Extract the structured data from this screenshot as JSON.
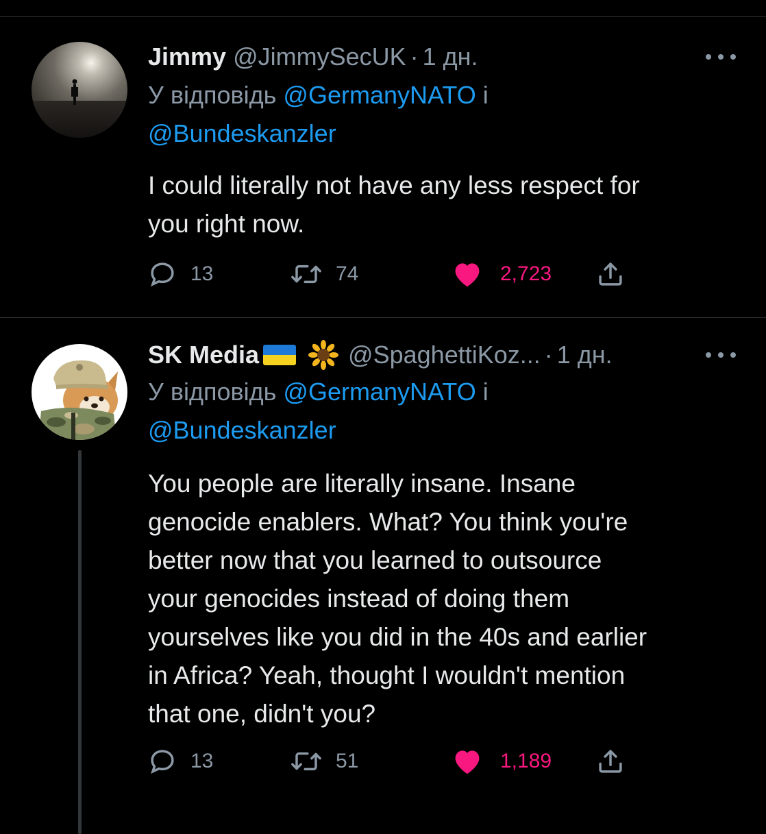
{
  "tweets": [
    {
      "name": "Jimmy",
      "handle": "@JimmySecUK",
      "separator": "·",
      "time": "1 дн.",
      "reply_prefix": "У відповідь",
      "reply_mention_1": "@GermanyNATO",
      "reply_conjunction": "і",
      "reply_mention_2": "@Bundeskanzler",
      "text_lines": [
        "I could literally not have any less respect for",
        "you right now."
      ],
      "replies": "13",
      "retweets": "74",
      "likes": "2,723",
      "liked": true
    },
    {
      "name": "SK Media",
      "emoji_flag": "ukraine-flag",
      "emoji_flower": "sunflower",
      "handle": "@SpaghettiKoz...",
      "separator": "·",
      "time": "1 дн.",
      "reply_prefix": "У відповідь",
      "reply_mention_1": "@GermanyNATO",
      "reply_conjunction": "і",
      "reply_mention_2": "@Bundeskanzler",
      "text_lines": [
        "You people are literally insane. Insane",
        "genocide enablers. What? You think you're",
        "better now that you learned to outsource",
        "your genocides instead of doing them",
        "yourselves like you did in the 40s and earlier",
        "in Africa? Yeah, thought I wouldn't mention",
        "that one, didn't you?"
      ],
      "replies": "13",
      "retweets": "51",
      "likes": "1,189",
      "liked": true
    }
  ],
  "colors": {
    "background": "#000000",
    "primary_text": "#e7e9ea",
    "secondary_text": "#8b98a5",
    "link": "#1d9bf0",
    "like": "#f91880",
    "divider": "#2f3336"
  }
}
